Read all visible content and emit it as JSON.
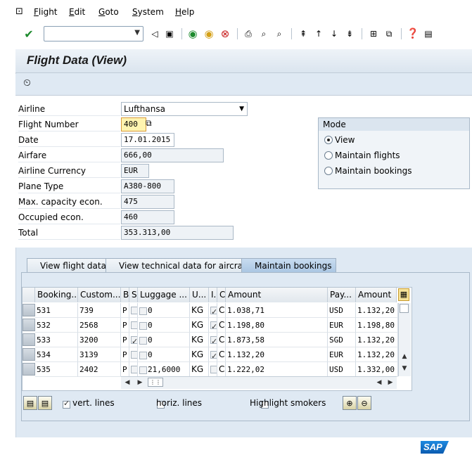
{
  "menu": {
    "items": [
      "Flight",
      "Edit",
      "Goto",
      "System",
      "Help"
    ]
  },
  "toolbar": {
    "command_field_value": ""
  },
  "screen": {
    "title": "Flight Data (View)"
  },
  "form": {
    "fields": [
      {
        "label": "Airline",
        "value": "Lufthansa"
      },
      {
        "label": "Flight Number",
        "value": "400"
      },
      {
        "label": "Date",
        "value": "17.01.2015"
      },
      {
        "label": "Airfare",
        "value": "666,00"
      },
      {
        "label": "Airline Currency",
        "value": "EUR"
      },
      {
        "label": "Plane Type",
        "value": "A380-800"
      },
      {
        "label": "Max. capacity econ.",
        "value": "475"
      },
      {
        "label": "Occupied econ.",
        "value": "460"
      },
      {
        "label": "Total",
        "value": "353.313,00"
      }
    ]
  },
  "mode": {
    "title": "Mode",
    "options": [
      "View",
      "Maintain flights",
      "Maintain bookings"
    ],
    "selected": "View"
  },
  "tabs": [
    "View flight data",
    "View technical data for aircraft",
    "Maintain bookings"
  ],
  "active_tab": "Maintain bookings",
  "bookings": {
    "headers": [
      "Booking...",
      "Custom...",
      "B",
      "S",
      "Luggage ...",
      "U...",
      "I.",
      "C",
      "Amount",
      "Pay...",
      "Amount"
    ],
    "rows": [
      {
        "booking": "531",
        "customer": "739",
        "b": "P",
        "s": false,
        "luggage": "0",
        "unit": "KG",
        "i": true,
        "c": "C",
        "amount": "1.038,71",
        "pay": "USD",
        "amount2": "1.132,20"
      },
      {
        "booking": "532",
        "customer": "2568",
        "b": "P",
        "s": false,
        "luggage": "0",
        "unit": "KG",
        "i": true,
        "c": "C",
        "amount": "1.198,80",
        "pay": "EUR",
        "amount2": "1.198,80"
      },
      {
        "booking": "533",
        "customer": "3200",
        "b": "P",
        "s": true,
        "luggage": "0",
        "unit": "KG",
        "i": true,
        "c": "C",
        "amount": "1.873,58",
        "pay": "SGD",
        "amount2": "1.132,20"
      },
      {
        "booking": "534",
        "customer": "3139",
        "b": "P",
        "s": false,
        "luggage": "0",
        "unit": "KG",
        "i": true,
        "c": "C",
        "amount": "1.132,20",
        "pay": "EUR",
        "amount2": "1.132,20"
      },
      {
        "booking": "535",
        "customer": "2402",
        "b": "P",
        "s": false,
        "luggage": "21,6000",
        "unit": "KG",
        "i": false,
        "c": "C",
        "amount": "1.222,02",
        "pay": "USD",
        "amount2": "1.332,00"
      }
    ]
  },
  "options": {
    "vert_lines": {
      "label": "vert. lines",
      "checked": true
    },
    "horiz_lines": {
      "label": "horiz. lines",
      "checked": false
    },
    "highlight_smokers": {
      "label": "Highlight smokers",
      "checked": false
    }
  },
  "brand": {
    "logo_text": "SAP",
    "accent": "#1f8ae0"
  }
}
